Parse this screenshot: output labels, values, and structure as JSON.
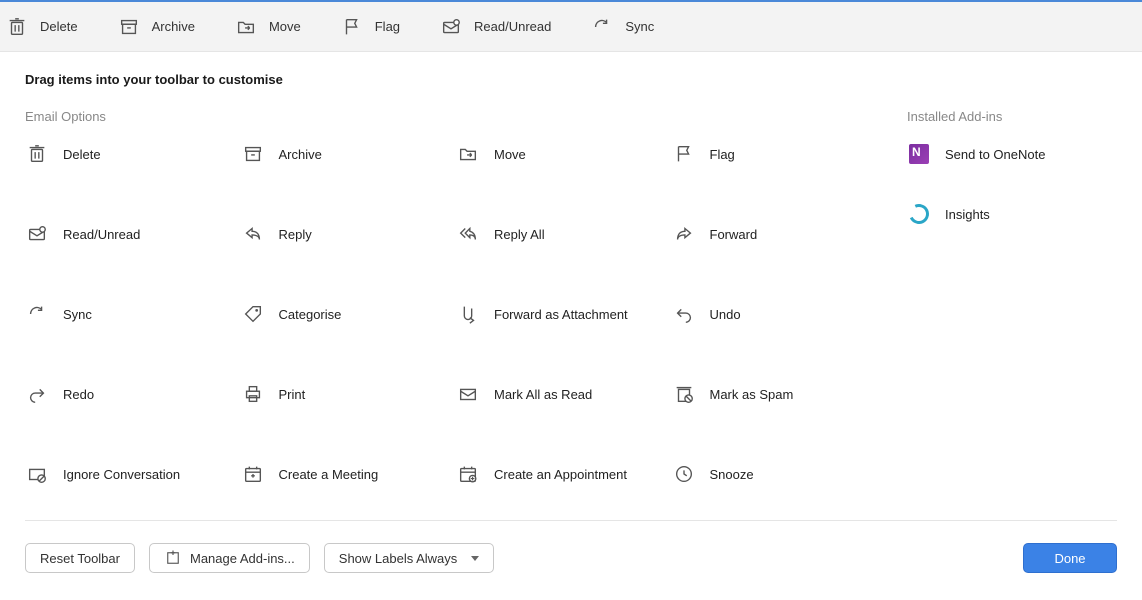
{
  "toolbar": {
    "items": [
      {
        "label": "Delete"
      },
      {
        "label": "Archive"
      },
      {
        "label": "Move"
      },
      {
        "label": "Flag"
      },
      {
        "label": "Read/Unread"
      },
      {
        "label": "Sync"
      }
    ]
  },
  "instruction": "Drag items into your toolbar to customise",
  "sections": {
    "email_options": {
      "title": "Email Options",
      "items": [
        "Delete",
        "Archive",
        "Move",
        "Flag",
        "Read/Unread",
        "Reply",
        "Reply All",
        "Forward",
        "Sync",
        "Categorise",
        "Forward as Attachment",
        "Undo",
        "Redo",
        "Print",
        "Mark All as Read",
        "Mark as Spam",
        "Ignore Conversation",
        "Create a Meeting",
        "Create an Appointment",
        "Snooze"
      ]
    },
    "addins": {
      "title": "Installed Add-ins",
      "items": [
        "Send to OneNote",
        "Insights"
      ]
    }
  },
  "footer": {
    "reset": "Reset Toolbar",
    "manage": "Manage Add-ins...",
    "show_labels": "Show Labels Always",
    "done": "Done"
  }
}
